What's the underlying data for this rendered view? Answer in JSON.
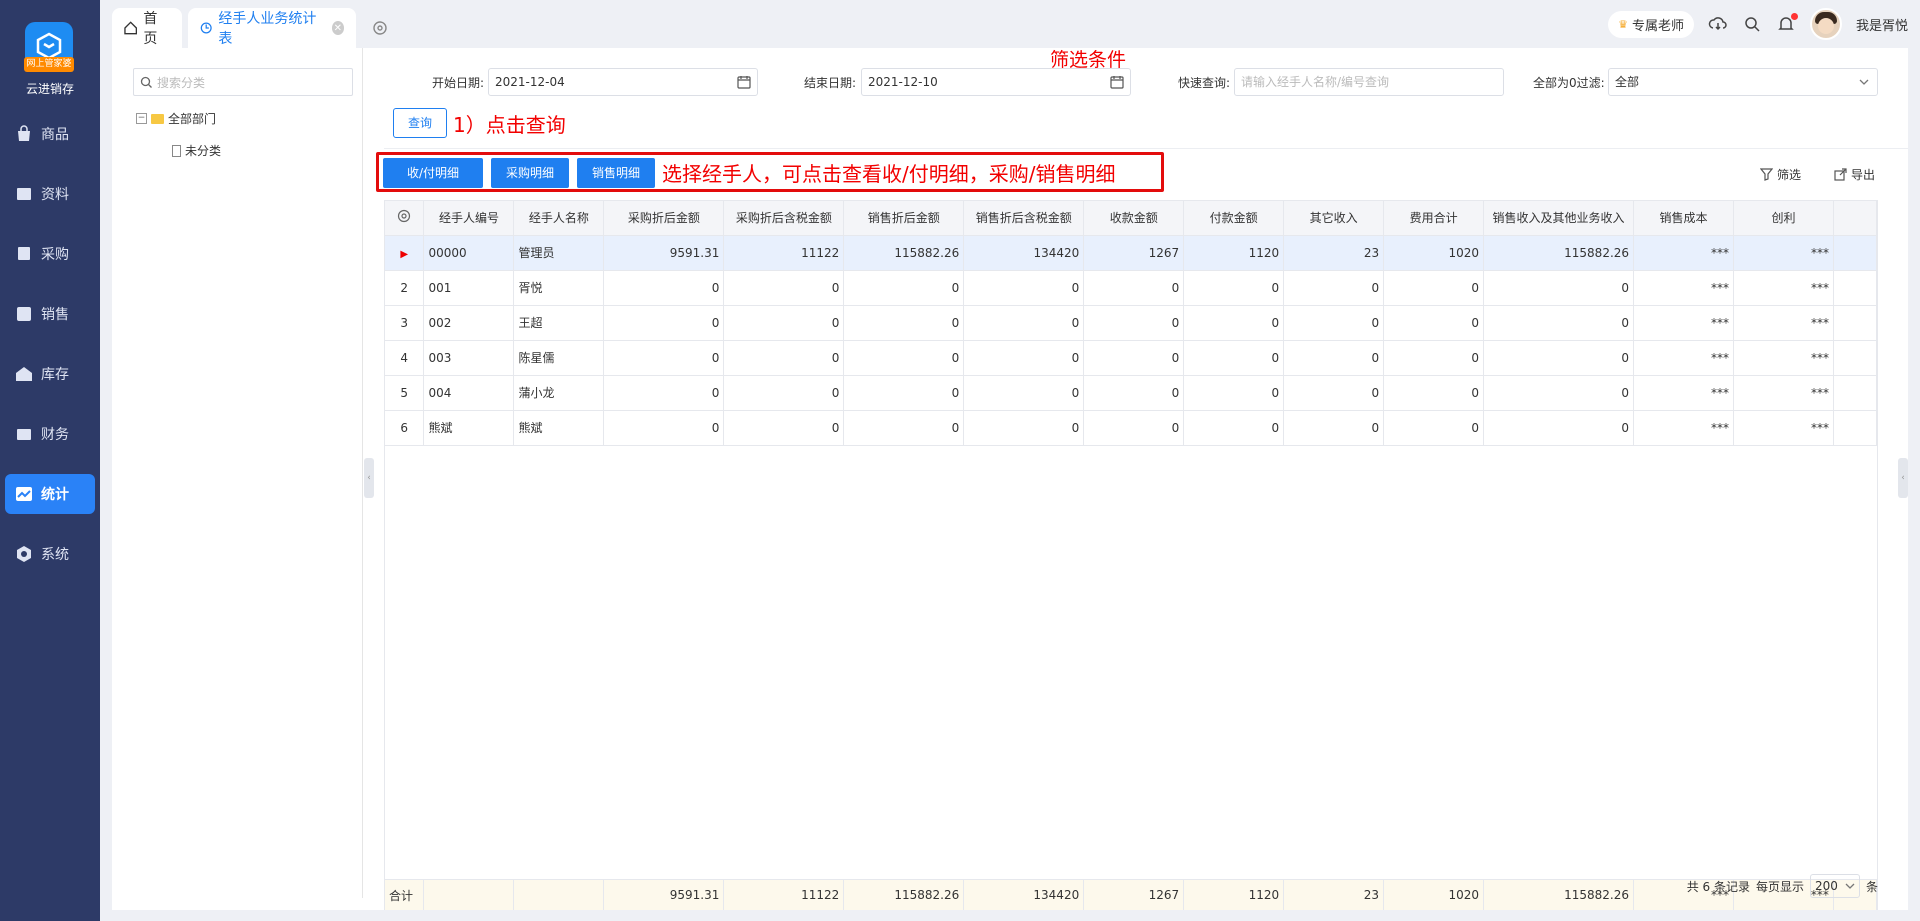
{
  "app": {
    "name": "云进销存",
    "logo_badge": "网上管家婆"
  },
  "nav": [
    {
      "label": "商品",
      "icon": "bag-icon"
    },
    {
      "label": "资料",
      "icon": "doc-icon"
    },
    {
      "label": "采购",
      "icon": "purchase-icon"
    },
    {
      "label": "销售",
      "icon": "sales-icon"
    },
    {
      "label": "库存",
      "icon": "warehouse-icon"
    },
    {
      "label": "财务",
      "icon": "finance-icon"
    },
    {
      "label": "统计",
      "icon": "stats-icon",
      "active": true
    },
    {
      "label": "系统",
      "icon": "gear-icon"
    }
  ],
  "tabs": [
    {
      "label": "首页"
    },
    {
      "label": "经手人业务统计表",
      "active": true
    }
  ],
  "topright": {
    "teacher": "专属老师",
    "user": "我是胥悦"
  },
  "tree": {
    "search_placeholder": "搜索分类",
    "root": "全部部门",
    "child": "未分类"
  },
  "filters": {
    "start_label": "开始日期:",
    "start_value": "2021-12-04",
    "end_label": "结束日期:",
    "end_value": "2021-12-10",
    "quick_label": "快速查询:",
    "quick_placeholder": "请输入经手人名称/编号查询",
    "zero_label": "全部为0过滤:",
    "zero_value": "全部",
    "query_button": "查询"
  },
  "annotations": {
    "filter": "筛选条件",
    "step1": "1）点击查询",
    "select": "选择经手人，可点击查看收/付明细，采购/销售明细"
  },
  "actions": {
    "receipt_detail": "收/付明细",
    "purchase_detail": "采购明细",
    "sales_detail": "销售明细",
    "filter": "筛选",
    "export": "导出"
  },
  "table": {
    "columns": [
      "经手人编号",
      "经手人名称",
      "采购折后金额",
      "采购折后含税金额",
      "销售折后金额",
      "销售折后含税金额",
      "收款金额",
      "付款金额",
      "其它收入",
      "费用合计",
      "销售收入及其他业务收入",
      "销售成本",
      "创利"
    ],
    "rows": [
      {
        "idx": "",
        "cells": [
          "00000",
          "管理员",
          "9591.31",
          "11122",
          "115882.26",
          "134420",
          "1267",
          "1120",
          "23",
          "1020",
          "115882.26",
          "***",
          "***"
        ]
      },
      {
        "idx": "2",
        "cells": [
          "001",
          "胥悦",
          "0",
          "0",
          "0",
          "0",
          "0",
          "0",
          "0",
          "0",
          "0",
          "***",
          "***"
        ]
      },
      {
        "idx": "3",
        "cells": [
          "002",
          "王超",
          "0",
          "0",
          "0",
          "0",
          "0",
          "0",
          "0",
          "0",
          "0",
          "***",
          "***"
        ]
      },
      {
        "idx": "4",
        "cells": [
          "003",
          "陈星儒",
          "0",
          "0",
          "0",
          "0",
          "0",
          "0",
          "0",
          "0",
          "0",
          "***",
          "***"
        ]
      },
      {
        "idx": "5",
        "cells": [
          "004",
          "蒲小龙",
          "0",
          "0",
          "0",
          "0",
          "0",
          "0",
          "0",
          "0",
          "0",
          "***",
          "***"
        ]
      },
      {
        "idx": "6",
        "cells": [
          "熊斌",
          "熊斌",
          "0",
          "0",
          "0",
          "0",
          "0",
          "0",
          "0",
          "0",
          "0",
          "***",
          "***"
        ]
      }
    ],
    "summary_label": "合计",
    "summary": [
      "",
      "",
      "9591.31",
      "11122",
      "115882.26",
      "134420",
      "1267",
      "1120",
      "23",
      "1020",
      "115882.26",
      "***",
      "***"
    ]
  },
  "pager": {
    "total": "共 6 条记录",
    "per_page_label": "每页显示",
    "per_page": "200",
    "unit": "条"
  }
}
